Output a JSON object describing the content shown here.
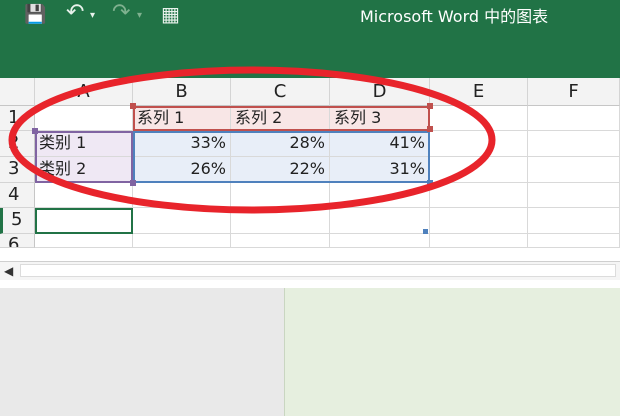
{
  "window": {
    "title": "Microsoft Word 中的图表"
  },
  "toolbar": {
    "save_icon": "💾",
    "undo_icon": "↶",
    "undo_arrow": "▾",
    "redo_icon": "↷",
    "redo_arrow": "▾",
    "edit_data_icon": "▦"
  },
  "sheet": {
    "columns": [
      "A",
      "B",
      "C",
      "D",
      "E",
      "F"
    ],
    "rows": [
      "1",
      "2",
      "3",
      "4",
      "5",
      "6"
    ],
    "headers": [
      "系列 1",
      "系列 2",
      "系列 3"
    ],
    "categories": [
      "类别 1",
      "类别 2"
    ],
    "values": [
      [
        "33%",
        "28%",
        "41%"
      ],
      [
        "26%",
        "22%",
        "31%"
      ]
    ]
  },
  "scrollbar": {
    "left_arrow": "◀"
  },
  "colors": {
    "ribbon": "#217346",
    "annotation": "#e8242b"
  }
}
